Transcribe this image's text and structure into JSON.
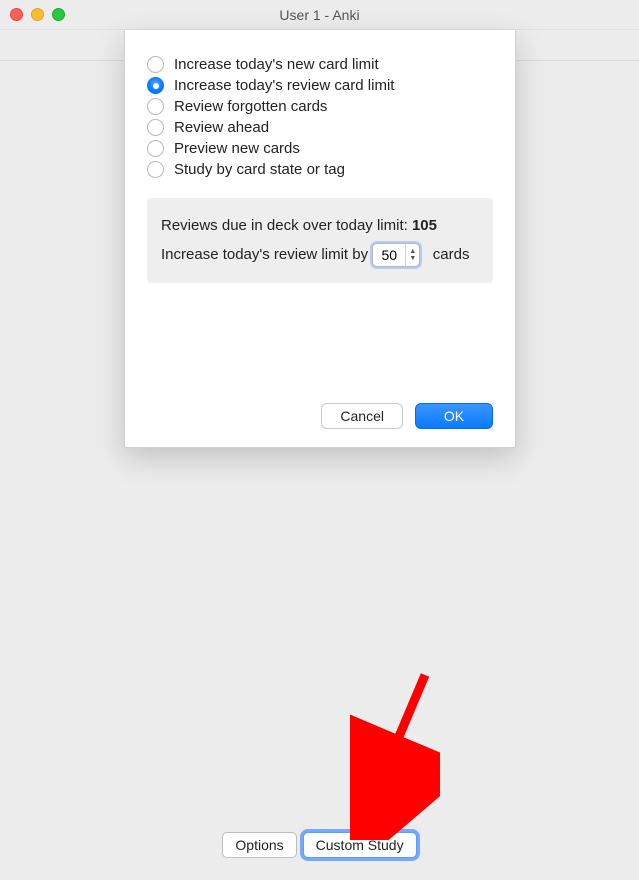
{
  "window": {
    "title": "User 1 - Anki"
  },
  "sheet": {
    "options": [
      {
        "label": "Increase today's new card limit",
        "selected": false
      },
      {
        "label": "Increase today's review card limit",
        "selected": true
      },
      {
        "label": "Review forgotten cards",
        "selected": false
      },
      {
        "label": "Review ahead",
        "selected": false
      },
      {
        "label": "Preview new cards",
        "selected": false
      },
      {
        "label": "Study by card state or tag",
        "selected": false
      }
    ],
    "panel": {
      "due_label_prefix": "Reviews due in deck over today limit: ",
      "due_value": "105",
      "increase_label_prefix": "Increase today's review limit by",
      "increase_value": "50",
      "increase_label_suffix": "cards"
    },
    "buttons": {
      "cancel": "Cancel",
      "ok": "OK"
    }
  },
  "bottom": {
    "options": "Options",
    "custom_study": "Custom Study"
  }
}
